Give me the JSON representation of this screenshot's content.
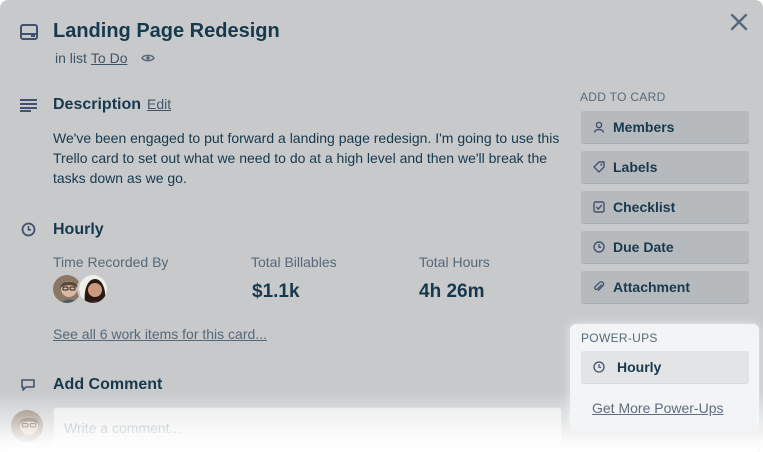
{
  "card": {
    "title": "Landing Page Redesign",
    "list_prefix": "in list",
    "list_name": "To Do"
  },
  "description": {
    "heading": "Description",
    "edit_label": "Edit",
    "text": "We've been engaged to put forward a landing page redesign. I'm going to use this Trello card to set out what we need to do at a high level and then we'll break the tasks down as we go."
  },
  "hourly": {
    "heading": "Hourly",
    "time_recorded_label": "Time Recorded By",
    "total_billables_label": "Total Billables",
    "total_billables_value": "$1.1k",
    "total_hours_label": "Total Hours",
    "total_hours_value": "4h 26m",
    "see_all_link": "See all 6 work items for this card..."
  },
  "comment": {
    "heading": "Add Comment",
    "placeholder": "Write a comment..."
  },
  "sidebar": {
    "add_to_card_heading": "ADD TO CARD",
    "buttons": [
      {
        "label": "Members",
        "icon": "person-icon"
      },
      {
        "label": "Labels",
        "icon": "tag-icon"
      },
      {
        "label": "Checklist",
        "icon": "checkbox-icon"
      },
      {
        "label": "Due Date",
        "icon": "clock-icon"
      },
      {
        "label": "Attachment",
        "icon": "paperclip-icon"
      }
    ],
    "powerups_heading": "POWER-UPS",
    "powerup_button": "Hourly",
    "get_more_link": "Get More Power-Ups"
  },
  "colors": {
    "modal_bg": "#c7c9cb",
    "text_dark": "#17394d",
    "button_bg": "#b7babd",
    "powerups_bg": "#f3f4f5"
  }
}
